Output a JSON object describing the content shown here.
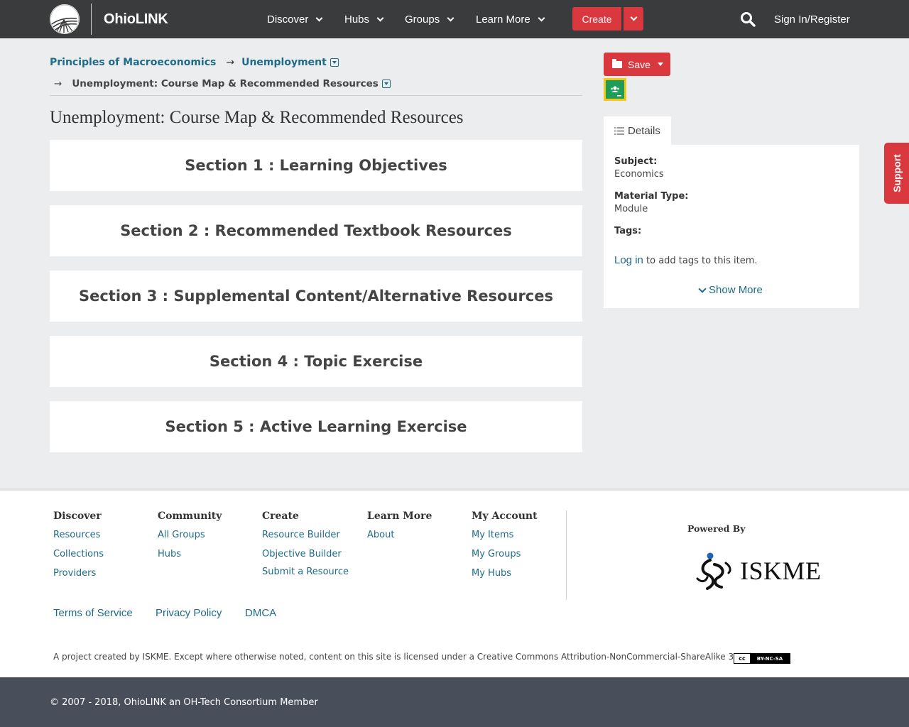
{
  "brand": {
    "name": "OhioLINK"
  },
  "nav": {
    "items": [
      {
        "label": "Discover"
      },
      {
        "label": "Hubs"
      },
      {
        "label": "Groups"
      },
      {
        "label": "Learn More"
      }
    ],
    "create_label": "Create",
    "signin_label": "Sign In/Register",
    "search_icon": "search-icon"
  },
  "breadcrumb": {
    "items": [
      {
        "label": "Principles of Macroeconomics"
      },
      {
        "label": "Unemployment"
      },
      {
        "label": "Unemployment: Course Map & Recommended Resources"
      }
    ],
    "separator": "→"
  },
  "page_title": "Unemployment: Course Map & Recommended Resources",
  "sections": [
    {
      "title": "Section 1 : Learning Objectives"
    },
    {
      "title": "Section 2 : Recommended Textbook Resources"
    },
    {
      "title": "Section 3 : Supplemental Content/Alternative Resources"
    },
    {
      "title": "Section 4 : Topic Exercise"
    },
    {
      "title": "Section 5 : Active Learning Exercise"
    }
  ],
  "sidebar": {
    "save_label": "Save",
    "details_tab": "Details",
    "subject_label": "Subject:",
    "subject_value": "Economics",
    "material_label": "Material Type:",
    "material_value": "Module",
    "tags_label": "Tags:",
    "login_link": "Log in",
    "login_suffix": " to add tags to this item.",
    "show_more": "Show More"
  },
  "support_label": "Support",
  "footer": {
    "columns": [
      {
        "heading": "Discover",
        "links": [
          "Resources",
          "Collections",
          "Providers"
        ]
      },
      {
        "heading": "Community",
        "links": [
          "All Groups",
          "Hubs"
        ]
      },
      {
        "heading": "Create",
        "links": [
          "Resource Builder",
          "Objective Builder",
          "Submit a Resource"
        ]
      },
      {
        "heading": "Learn More",
        "links": [
          "About"
        ]
      },
      {
        "heading": "My Account",
        "links": [
          "My Items",
          "My Groups",
          "My Hubs"
        ]
      }
    ],
    "powered_by": "Powered By",
    "iskme_logo_text": "ISKME",
    "legal": [
      "Terms of Service",
      "Privacy Policy",
      "DMCA"
    ],
    "license_text": "A project created by ISKME. Except where otherwise noted, content on this site is licensed under a Creative Commons Attribution-NonCommercial-ShareAlike 3.0 License.",
    "cc_badge": {
      "cc": "cc",
      "terms": "BY-NC-SA"
    },
    "copyright": "© 2007 - 2018, OhioLINK an OH-Tech Consortium Member"
  },
  "colors": {
    "topbar": "#3a3b3c",
    "accent_red": "#d9383f",
    "link": "#1f6b88",
    "page_bg": "#ebedee",
    "bottombar": "#494e5b"
  }
}
